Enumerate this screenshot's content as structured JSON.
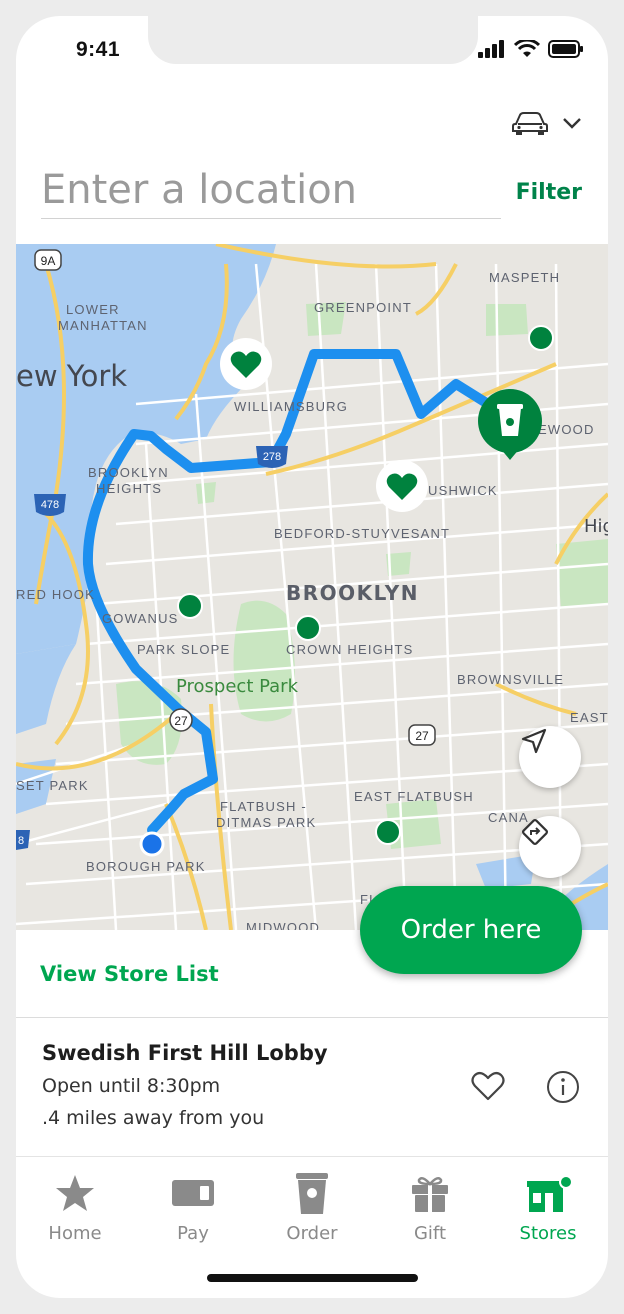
{
  "status": {
    "time": "9:41"
  },
  "search": {
    "placeholder": "Enter a location",
    "filter_label": "Filter"
  },
  "map": {
    "labels": {
      "ny": "ew York",
      "lower_manhattan_1": "LOWER",
      "lower_manhattan_2": "MANHATTAN",
      "greenpoint": "GREENPOINT",
      "maspeth": "MASPETH",
      "williamsburg": "WILLIAMSBURG",
      "ridgewood": "EWOOD",
      "bushwick": "USHWICK",
      "brooklyn_heights_1": "BROOKLYN",
      "brooklyn_heights_2": "HEIGHTS",
      "bed_stuy": "BEDFORD-STUYVESANT",
      "brooklyn": "BROOKLYN",
      "highland": "Highla",
      "red_hook": "RED HOOK",
      "gowanus": "GOWANUS",
      "park_slope": "PARK SLOPE",
      "crown_heights": "CROWN HEIGHTS",
      "prospect_park": "Prospect Park",
      "brownsville": "BROWNSVILLE",
      "east": "EAST",
      "sunset_park": "SET PARK",
      "flatbush_1": "FLATBUSH -",
      "flatbush_2": "DITMAS PARK",
      "east_flatbush": "EAST FLATBUSH",
      "canarsie": "CANA",
      "borough_park": "BOROUGH PARK",
      "flatlands": "FLATLANDS",
      "midwood": "MIDWOOD",
      "shield_9a": "9A",
      "shield_278": "278",
      "shield_478": "478",
      "shield_27a": "27",
      "shield_27b": "27",
      "shield_left": "8"
    }
  },
  "order_button": "Order here",
  "view_store_list": "View Store List",
  "store": {
    "name": "Swedish First Hill Lobby",
    "hours": "Open until 8:30pm",
    "distance": ".4 miles away from you"
  },
  "tabs": [
    {
      "label": "Home",
      "icon": "star-icon"
    },
    {
      "label": "Pay",
      "icon": "card-icon"
    },
    {
      "label": "Order",
      "icon": "cup-icon"
    },
    {
      "label": "Gift",
      "icon": "gift-icon"
    },
    {
      "label": "Stores",
      "icon": "store-icon"
    }
  ],
  "colors": {
    "brand_green": "#00a650",
    "dark_green": "#00834a",
    "route_blue": "#1d8fef",
    "location_blue": "#1a73e8"
  }
}
